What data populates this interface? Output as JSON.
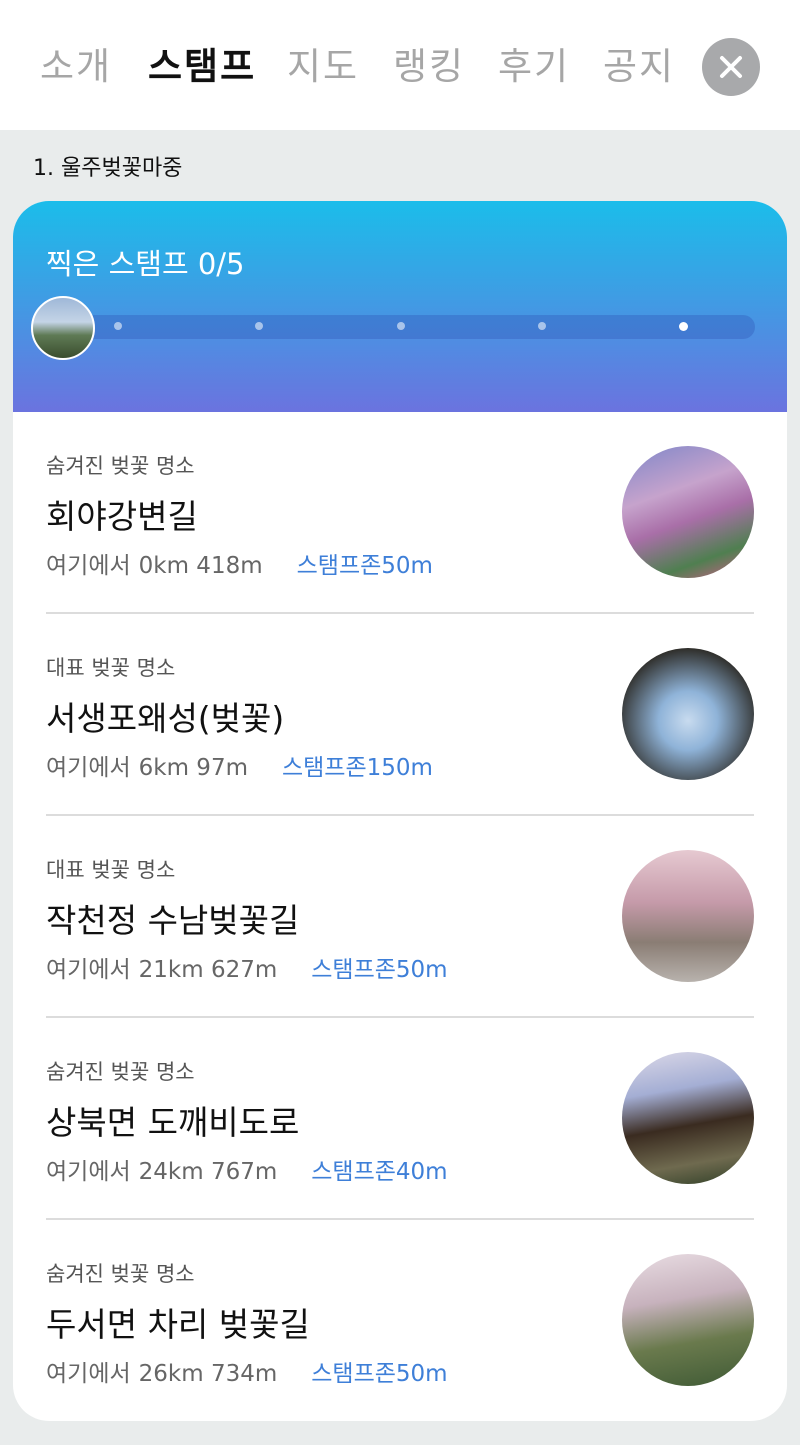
{
  "tabs": [
    {
      "label": "소개"
    },
    {
      "label": "스탬프"
    },
    {
      "label": "지도"
    },
    {
      "label": "랭킹"
    },
    {
      "label": "후기"
    },
    {
      "label": "공지"
    }
  ],
  "active_tab": "스탬프",
  "close_icon": "close-icon",
  "course": {
    "title": "1. 울주벚꽃마중"
  },
  "stamp_header": {
    "count_text": "찍은 스탬프 0/5",
    "collected": 0,
    "total": 5
  },
  "spots": [
    {
      "category": "숨겨진 벚꽃 명소",
      "name": "회야강변길",
      "distance_label": "여기에서",
      "distance": "0km 418m",
      "zone": "스탬프존50m"
    },
    {
      "category": "대표 벚꽃 명소",
      "name": "서생포왜성(벚꽃)",
      "distance_label": "여기에서",
      "distance": "6km 97m",
      "zone": "스탬프존150m"
    },
    {
      "category": "대표 벚꽃 명소",
      "name": "작천정 수남벚꽃길",
      "distance_label": "여기에서",
      "distance": "21km 627m",
      "zone": "스탬프존50m"
    },
    {
      "category": "숨겨진 벚꽃 명소",
      "name": "상북면 도깨비도로",
      "distance_label": "여기에서",
      "distance": "24km 767m",
      "zone": "스탬프존40m"
    },
    {
      "category": "숨겨진 벚꽃 명소",
      "name": "두서면 차리 벚꽃길",
      "distance_label": "여기에서",
      "distance": "26km 734m",
      "zone": "스탬프존50m"
    }
  ],
  "colors": {
    "accent_blue": "#3e7fd8",
    "header_gradient_top": "#1bbdea",
    "header_gradient_bottom": "#6b73df",
    "close_button": "#a8a9ab"
  }
}
